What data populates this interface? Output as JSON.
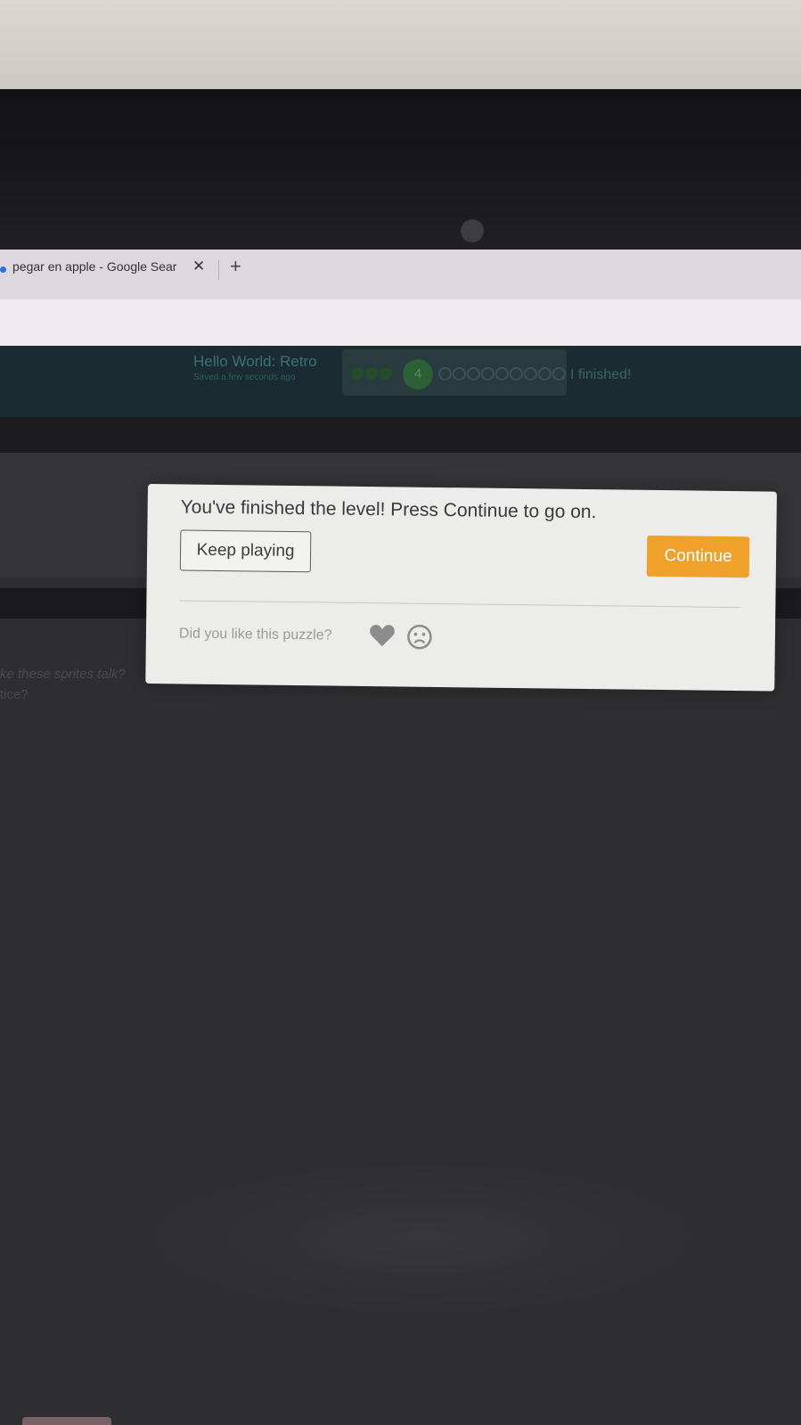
{
  "browser": {
    "tab_title": "pegar en apple - Google Sear",
    "tab_close": "✕",
    "new_tab": "+"
  },
  "app": {
    "title": "Hello World: Retro",
    "saved_status": "Saved a few seconds ago",
    "current_level": "4",
    "finished_label": "I finished!"
  },
  "instructions": {
    "line1": "ke these sprites talk?",
    "line2": "tice?"
  },
  "dialog": {
    "message": "You've finished the level! Press Continue to go on.",
    "keep_playing": "Keep playing",
    "continue": "Continue",
    "feedback_prompt": "Did you like this puzzle?",
    "colors": {
      "continue": "#f0a12c",
      "background": "#ececea"
    }
  },
  "icons": {
    "like": "heart-icon",
    "dislike": "sad-face-icon"
  }
}
